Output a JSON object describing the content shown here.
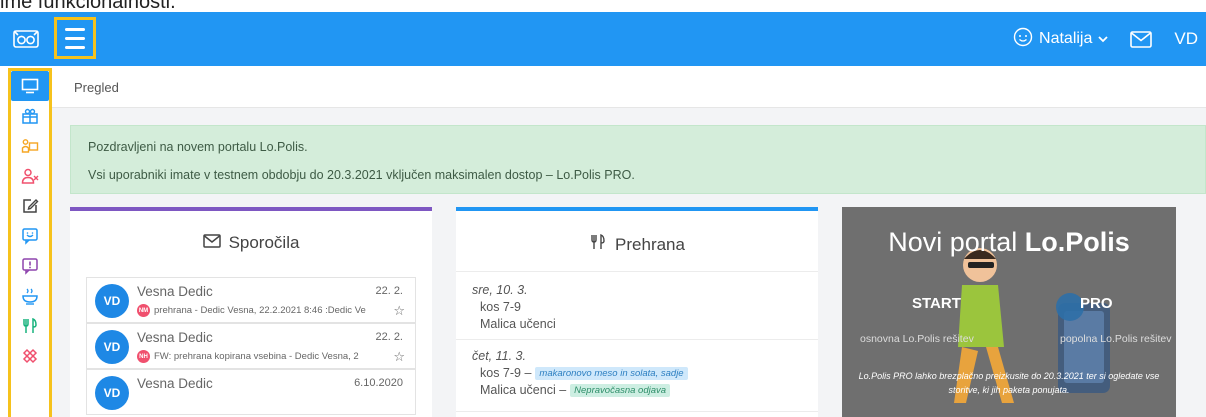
{
  "caption": "ime funkcionalnosti.",
  "header": {
    "logo_icon": "lopolis-owl-icon",
    "menu_icon": "hamburger-icon",
    "user_name": "Natalija",
    "user_icon": "smiley-face-icon",
    "mail_icon": "envelope-icon",
    "initials": "VD",
    "accent": "#2196f3",
    "highlight": "#f6c21c"
  },
  "sidebar": {
    "items": [
      {
        "icon": "monitor-icon",
        "color": "#ffffff",
        "active": true
      },
      {
        "icon": "gift-icon",
        "color": "#2196f3"
      },
      {
        "icon": "teacher-board-icon",
        "color": "#f5a623"
      },
      {
        "icon": "user-remove-icon",
        "color": "#f0506e"
      },
      {
        "icon": "edit-icon",
        "color": "#444444"
      },
      {
        "icon": "smiley-chat-icon",
        "color": "#2196f3"
      },
      {
        "icon": "alert-chat-icon",
        "color": "#8e44ad"
      },
      {
        "icon": "bowl-icon",
        "color": "#2196f3"
      },
      {
        "icon": "cutlery-icon",
        "color": "#18b37e"
      },
      {
        "icon": "bandage-icon",
        "color": "#f0506e"
      }
    ]
  },
  "breadcrumb": "Pregled",
  "alert": {
    "line1": "Pozdravljeni na novem portalu Lo.Polis.",
    "line2": "Vsi uporabniki imate v testnem obdobju do 20.3.2021 vključen maksimalen dostop – Lo.Polis PRO."
  },
  "messages_card": {
    "title": "Sporočila",
    "icon": "envelope-icon",
    "accent": "#7e57c2",
    "items": [
      {
        "initials": "VD",
        "name": "Vesna Dedic",
        "date": "22. 2.",
        "badge": "NM",
        "preview": "prehrana - Dedic Vesna, 22.2.2021 8:46 :Dedic Ve"
      },
      {
        "initials": "VD",
        "name": "Vesna Dedic",
        "date": "22. 2.",
        "badge": "NH",
        "preview": "FW: prehrana kopirana vsebina - Dedic Vesna, 2"
      },
      {
        "initials": "VD",
        "name": "Vesna Dedic",
        "date": "6.10.2020",
        "badge": "",
        "preview": ""
      }
    ]
  },
  "food_card": {
    "title": "Prehrana",
    "icon": "cutlery-icon",
    "accent": "#2196f3",
    "days": [
      {
        "day": "sre, 10. 3.",
        "rows": [
          {
            "meal": "kos 7-9",
            "tag": "",
            "tag_style": ""
          },
          {
            "meal": "Malica učenci",
            "tag": "",
            "tag_style": ""
          }
        ]
      },
      {
        "day": "čet, 11. 3.",
        "rows": [
          {
            "meal": "kos 7-9 –",
            "tag": "makaronovo meso in solata, sadje",
            "tag_style": "blue"
          },
          {
            "meal": "Malica učenci –",
            "tag": "Nepravočasna odjava",
            "tag_style": "green"
          }
        ]
      }
    ]
  },
  "promo": {
    "title_plain": "Novi portal ",
    "title_bold": "Lo.Polis",
    "start": "START",
    "pro": "PRO",
    "start_sub": "osnovna Lo.Polis rešitev",
    "pro_sub": "popolna Lo.Polis rešitev",
    "footer": "Lo.Polis PRO lahko brezplačno preizkusite do 20.3.2021 ter si ogledate vse storitve, ki jih paketa ponujata."
  }
}
